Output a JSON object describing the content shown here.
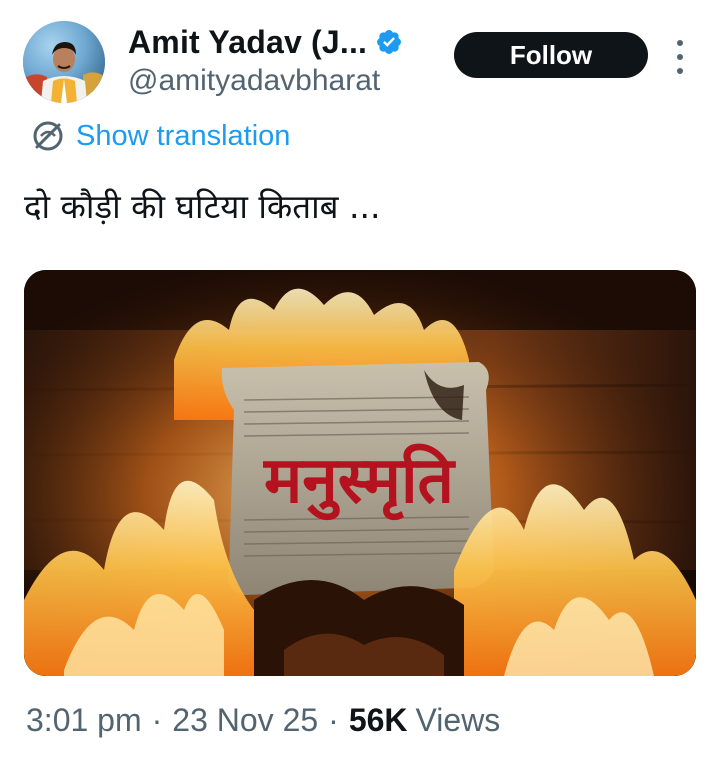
{
  "author": {
    "display_name": "Amit Yadav (J...",
    "handle": "@amityadavbharat",
    "verified": true
  },
  "actions": {
    "follow_label": "Follow"
  },
  "translation": {
    "label": "Show translation"
  },
  "tweet": {
    "text": "दो कौड़ी की घटिया किताब ..."
  },
  "media": {
    "overlay_text": "मनुस्मृति"
  },
  "meta": {
    "time": "3:01 pm",
    "separator": "·",
    "date": "23 Nov 25",
    "views_count": "56K",
    "views_label": "Views"
  },
  "colors": {
    "text_primary": "#0f1419",
    "text_secondary": "#536471",
    "link_blue": "#1d9bf0",
    "follow_bg": "#0f1419",
    "verified_blue": "#1d9bf0"
  },
  "icons": {
    "verified": "verified-badge-icon",
    "translate": "translate-icon",
    "more": "more-vertical-icon"
  }
}
